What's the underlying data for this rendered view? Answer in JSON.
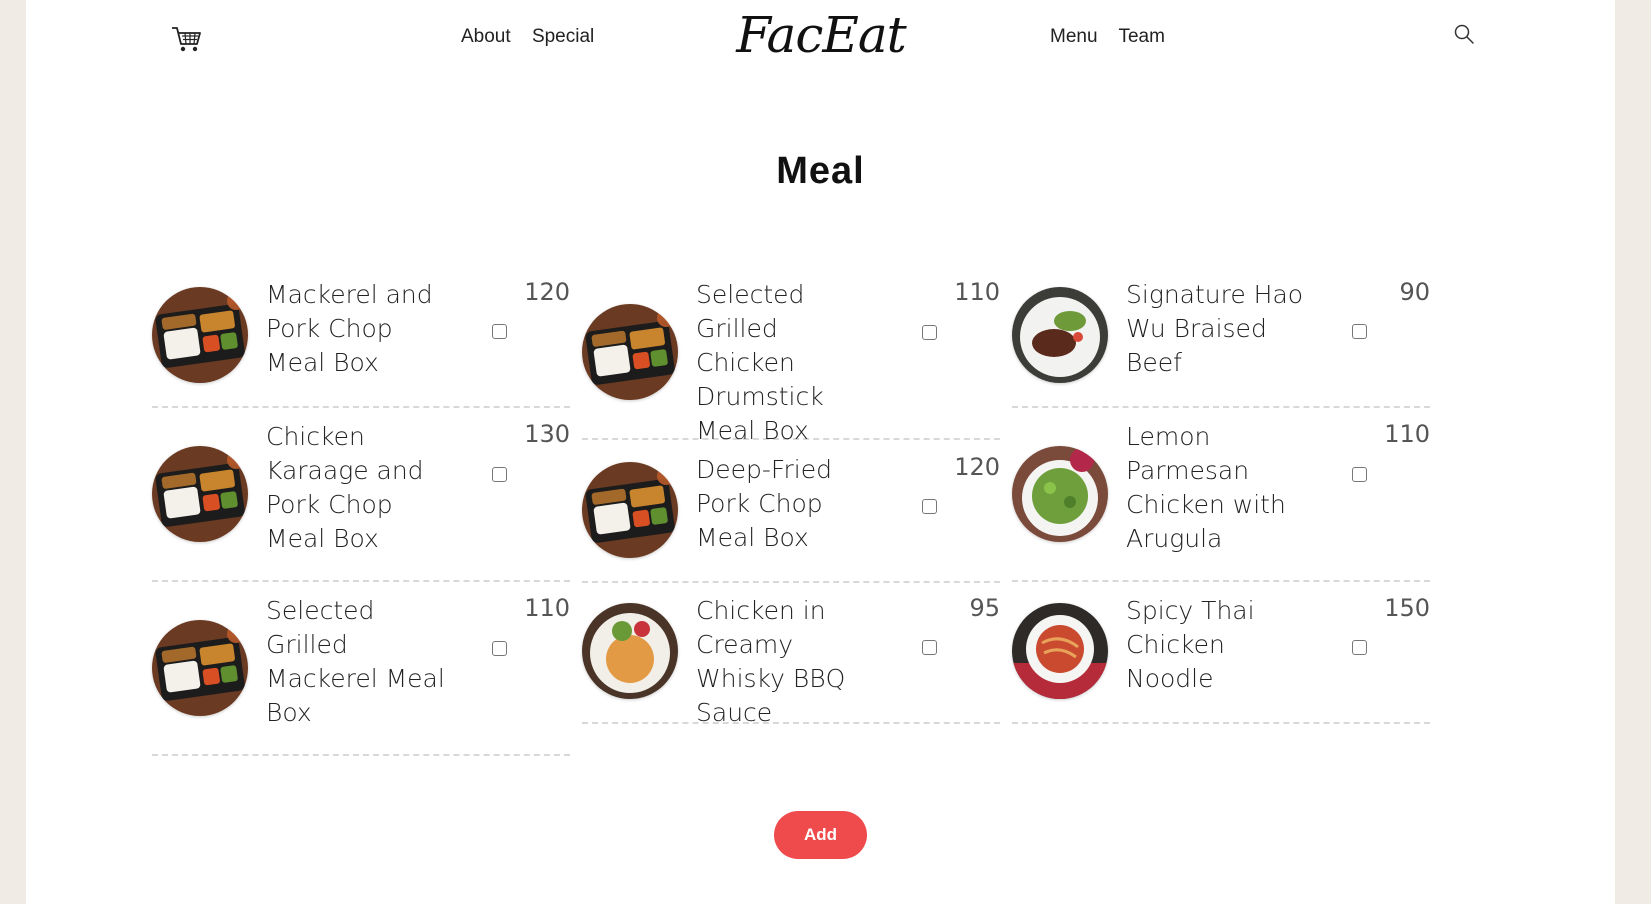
{
  "header": {
    "logo": "FacEat",
    "nav_left": [
      "About",
      "Special"
    ],
    "nav_right": [
      "Menu",
      "Team"
    ]
  },
  "title": "Meal",
  "items": [
    {
      "name": "Mackerel and Pork Chop Meal Box",
      "price": "120",
      "checked": false,
      "image": "bento-box"
    },
    {
      "name": "Selected Grilled Chicken Drumstick Meal Box",
      "price": "110",
      "checked": false,
      "image": "bento-box"
    },
    {
      "name": "Signature Hao Wu Braised Beef",
      "price": "90",
      "checked": false,
      "image": "beef-plate"
    },
    {
      "name": "Chicken Karaage and Pork Chop Meal Box",
      "price": "130",
      "checked": false,
      "image": "bento-box"
    },
    {
      "name": "Deep-Fried Pork Chop Meal Box",
      "price": "120",
      "checked": false,
      "image": "bento-box"
    },
    {
      "name": "Lemon Parmesan Chicken with Arugula",
      "price": "110",
      "checked": false,
      "image": "salad-bowl"
    },
    {
      "name": "Selected Grilled Mackerel Meal Box",
      "price": "110",
      "checked": false,
      "image": "bento-box"
    },
    {
      "name": "Chicken in Creamy Whisky BBQ Sauce",
      "price": "95",
      "checked": false,
      "image": "chicken-plate"
    },
    {
      "name": "Spicy Thai Chicken Noodle",
      "price": "150",
      "checked": false,
      "image": "noodle-bowl"
    }
  ],
  "add_button": "Add",
  "colors": {
    "accent": "#ef4b4c",
    "background": "#f1ebe6",
    "page": "#ffffff"
  }
}
